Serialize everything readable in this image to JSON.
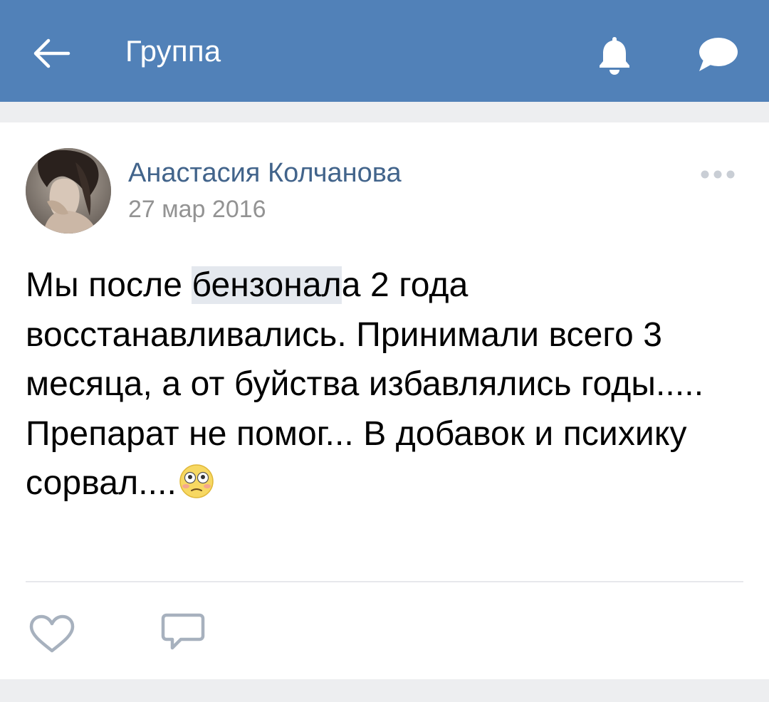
{
  "header": {
    "title": "Группа",
    "background": "#5181b8",
    "icons": [
      "arrow-left-icon",
      "bell-icon",
      "message-bubble-icon"
    ]
  },
  "post": {
    "author": "Анастасия Колчанова",
    "date": "27 мар 2016",
    "text": {
      "part1": "Мы после ",
      "highlight": "бензонал",
      "part2": "а 2 года восстанавливались. Принимали всего 3 месяца, а от буйства избавлялись годы..... Препарат не помог... В добавок и психику сорвал...."
    },
    "emoji": "flushed-face",
    "author_color": "#42648b",
    "actions": [
      "heart-icon",
      "comment-icon"
    ]
  }
}
